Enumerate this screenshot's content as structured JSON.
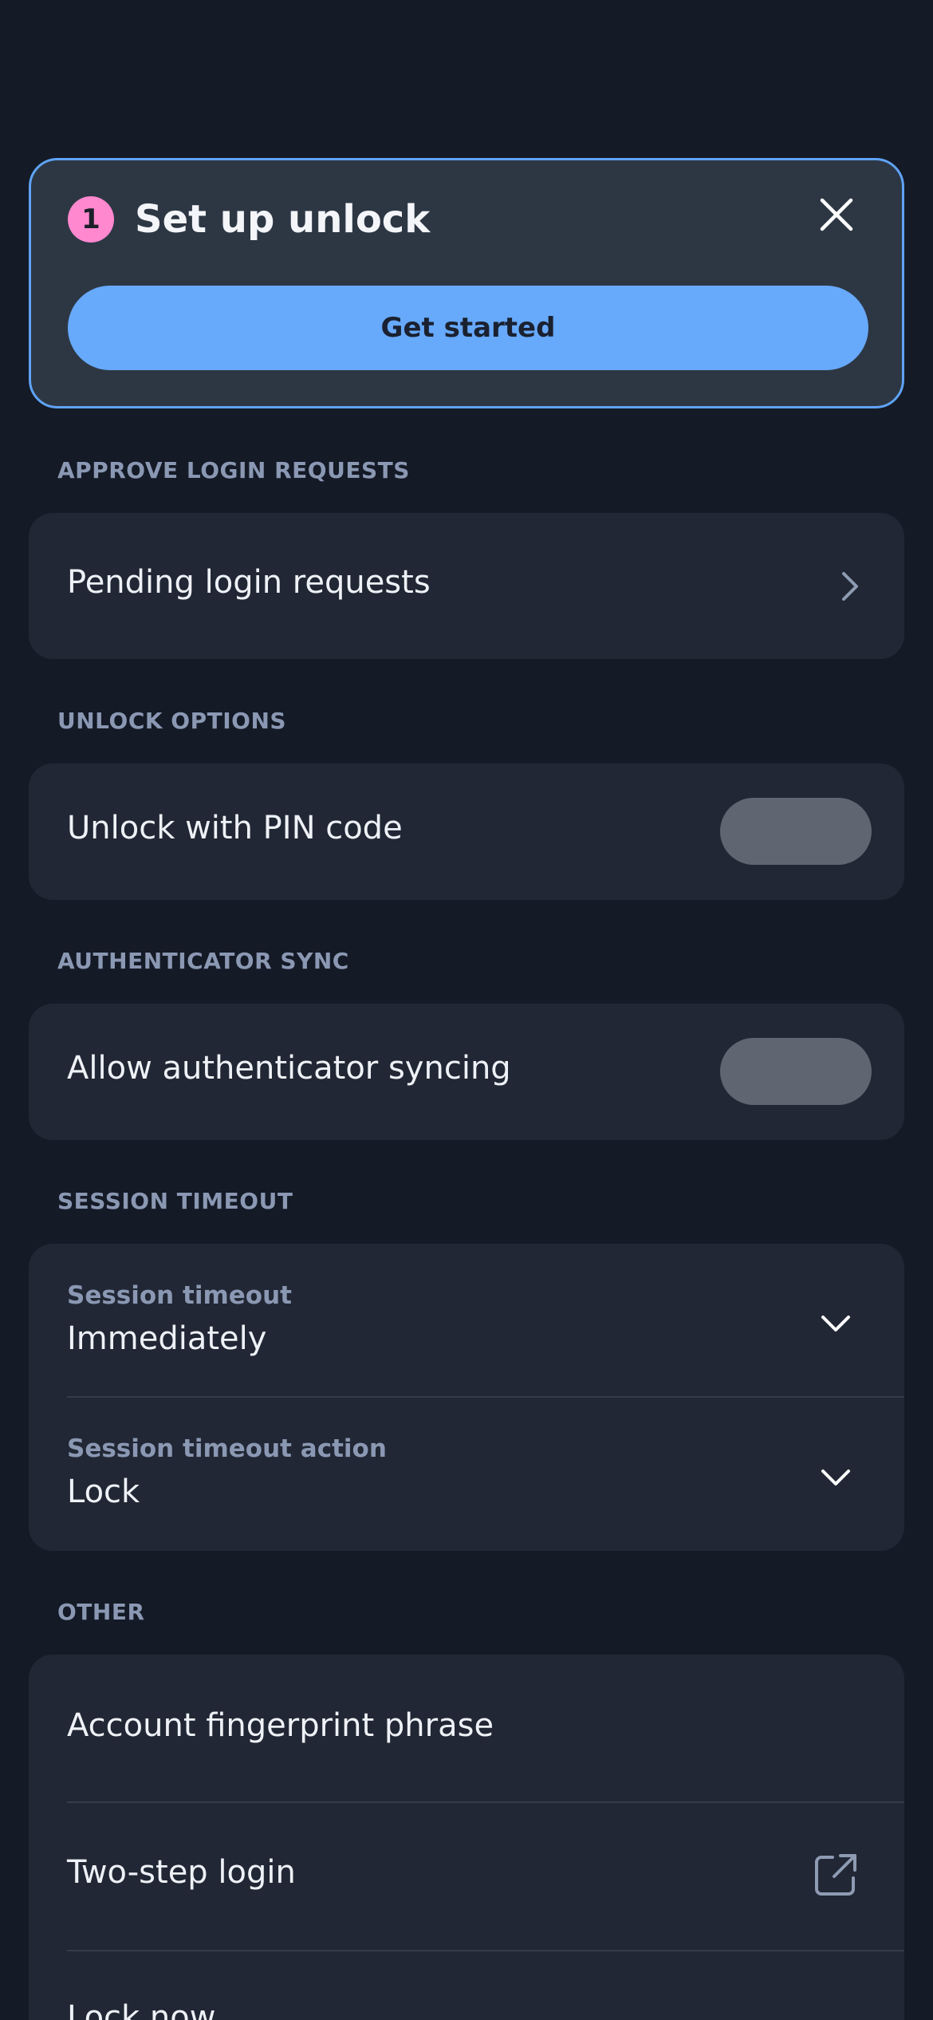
{
  "setup": {
    "step_number": "1",
    "title": "Set up unlock",
    "cta_label": "Get started"
  },
  "sections": {
    "approve": {
      "header": "APPROVE LOGIN REQUESTS",
      "items": [
        {
          "label": "Pending login requests"
        }
      ]
    },
    "unlock": {
      "header": "UNLOCK OPTIONS",
      "items": [
        {
          "label": "Unlock with PIN code",
          "enabled": false
        }
      ]
    },
    "sync": {
      "header": "AUTHENTICATOR SYNC",
      "items": [
        {
          "label": "Allow authenticator syncing",
          "enabled": false
        }
      ]
    },
    "session": {
      "header": "SESSION TIMEOUT",
      "timeout": {
        "label": "Session timeout",
        "value": "Immediately"
      },
      "action": {
        "label": "Session timeout action",
        "value": "Lock"
      }
    },
    "other": {
      "header": "OTHER",
      "items": [
        {
          "label": "Account fingerprint phrase"
        },
        {
          "label": "Two-step login"
        },
        {
          "label": "Lock now"
        }
      ]
    }
  },
  "colors": {
    "background": "#141a26",
    "card": "#212734",
    "accent": "#67a9fb",
    "badge": "#ff88cf",
    "toggle_off": "#5f6672"
  }
}
